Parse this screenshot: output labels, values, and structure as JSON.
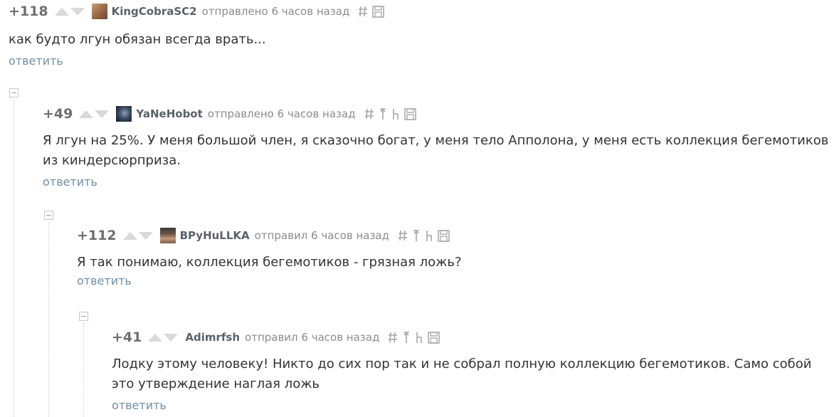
{
  "comments": [
    {
      "rating": "+118",
      "username": "KingCobraSC2",
      "meta": "отправлено 6 часов назад",
      "text": "как будто лгун обязан всегда врать...",
      "reply": "ответить"
    },
    {
      "rating": "+49",
      "username": "YaNeHobot",
      "meta": "отправлено 6 часов назад",
      "text": "Я лгун на 25%. У меня большой член, я сказочно богат, у меня тело Апполона, у меня есть коллекция бегемотиков из киндерсюрприза.",
      "reply": "ответить"
    },
    {
      "rating": "+112",
      "username": "BPyHuLLKA",
      "meta": "отправил 6 часов назад",
      "text": "Я так понимаю, коллекция бегемотиков - грязная ложь?",
      "reply": "ответить"
    },
    {
      "rating": "+41",
      "username": "Adimrfsh",
      "meta": "отправил 6 часов назад",
      "text": "Лодку этому человеку! Никто до сих пор так и не собрал полную коллекцию бегемотиков. Само собой это утверждение наглая ложь",
      "reply": "ответить"
    }
  ],
  "icons": {
    "permalink": "hash-icon",
    "to_parent": "arrow-up-icon",
    "to_branch": "branch-icon",
    "save": "save-icon",
    "collapse": "collapse-icon"
  },
  "colors": {
    "link": "#6f8fa6",
    "meta": "#8c8c8c",
    "rating": "#6f6f6f"
  }
}
